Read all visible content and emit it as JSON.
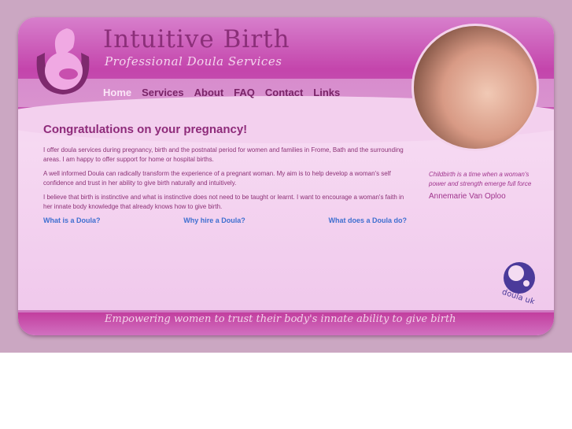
{
  "header": {
    "title": "Intuitive Birth",
    "subtitle": "Professional Doula Services"
  },
  "nav": [
    {
      "label": "Home",
      "active": true
    },
    {
      "label": "Services"
    },
    {
      "label": "About"
    },
    {
      "label": "FAQ"
    },
    {
      "label": "Contact"
    },
    {
      "label": "Links"
    }
  ],
  "main": {
    "heading": "Congratulations on your pregnancy!",
    "paragraphs": [
      "I offer doula services during pregnancy, birth and the postnatal period for women and families in Frome, Bath and the surrounding areas.  I am happy to offer support for home or hospital births.",
      "A well informed Doula can radically transform the experience of a pregnant woman. My aim is to help develop a woman's self confidence and trust in her ability to give birth naturally and intuitively.",
      "I believe that birth is instinctive and what is instinctive does not need to be taught or learnt. I want to encourage a woman's faith in her innate body knowledge that already knows how to give birth."
    ],
    "links": [
      "What is a Doula?",
      "Why hire a Doula?",
      "What does a Doula do?"
    ]
  },
  "quote": {
    "text": "Childbirth is a time when a woman's power and strength emerge full force",
    "author": "Annemarie Van Oploo"
  },
  "badge": {
    "text": "doula uk"
  },
  "footer": {
    "tagline": "Empowering women to trust their body's innate ability to give birth"
  }
}
